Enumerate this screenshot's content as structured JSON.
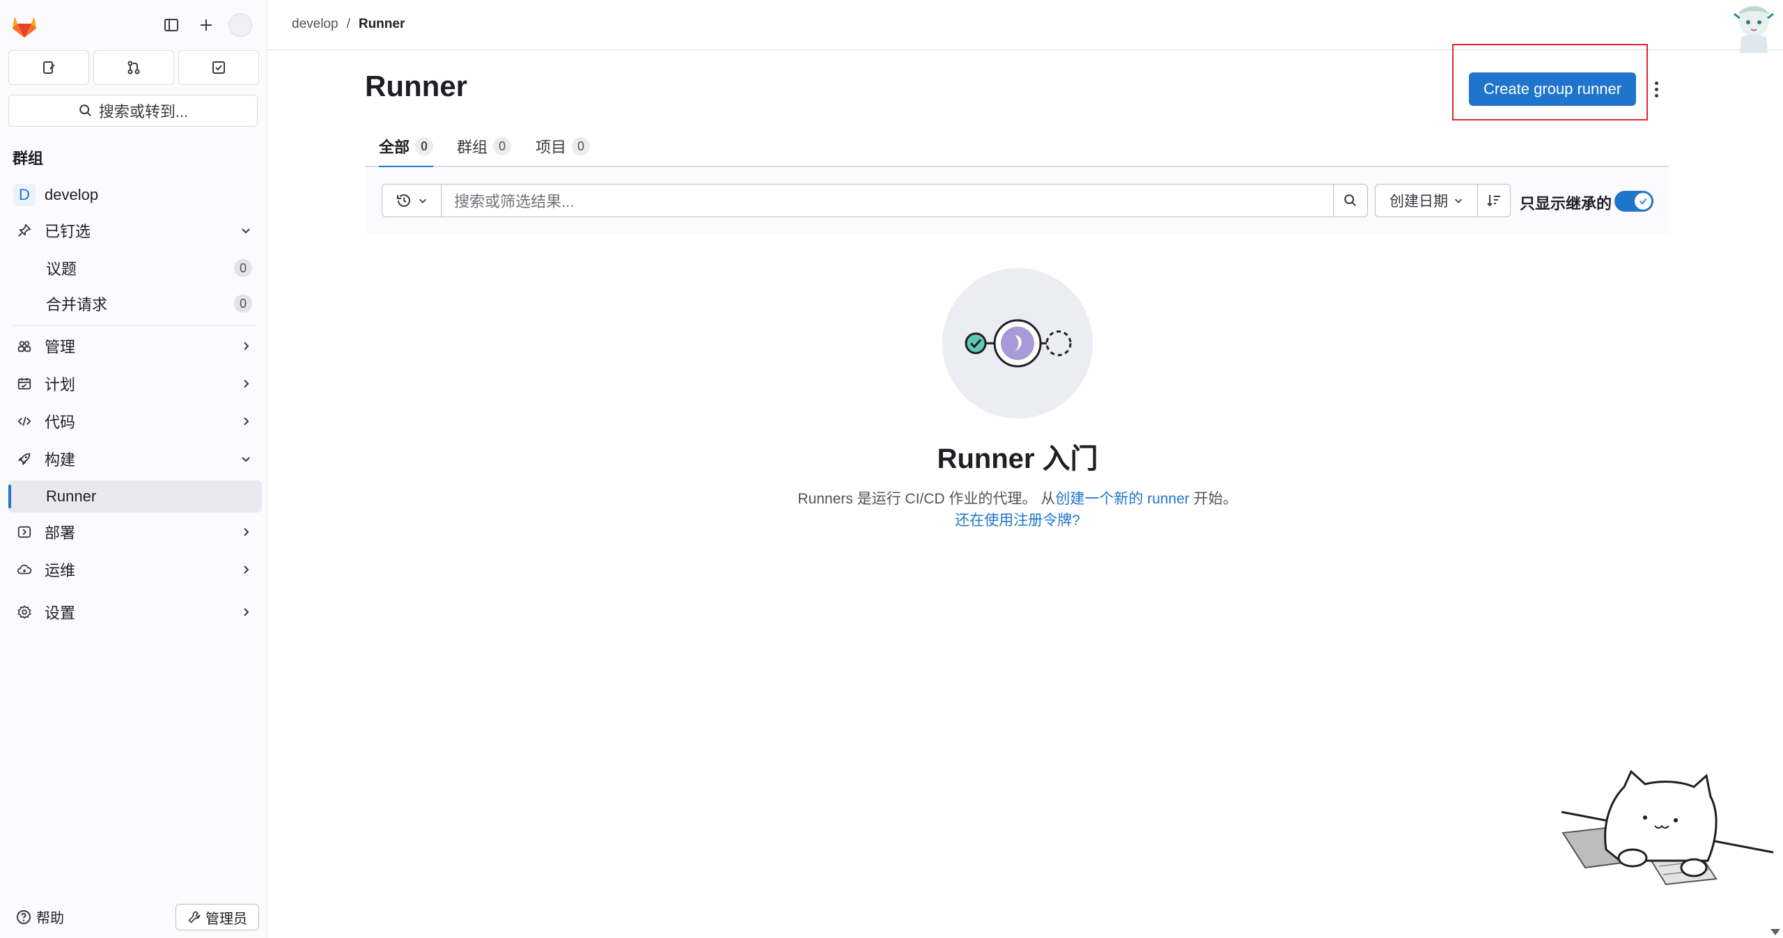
{
  "breadcrumb": {
    "parent": "develop",
    "separator": "/",
    "current": "Runner"
  },
  "sidebar": {
    "search_label": "搜索或转到...",
    "section_title": "群组",
    "group": {
      "avatar_letter": "D",
      "name": "develop"
    },
    "pinned": {
      "label": "已钉选",
      "items": [
        {
          "label": "议题",
          "count": "0"
        },
        {
          "label": "合并请求",
          "count": "0"
        }
      ]
    },
    "nav": {
      "manage": "管理",
      "plan": "计划",
      "code": "代码",
      "build": "构建",
      "runner": "Runner",
      "deploy": "部署",
      "operate": "运维",
      "settings": "设置"
    },
    "help": "帮助",
    "admin": "管理员"
  },
  "page": {
    "title": "Runner",
    "create_button": "Create group runner",
    "tabs": [
      {
        "label": "全部",
        "count": "0"
      },
      {
        "label": "群组",
        "count": "0"
      },
      {
        "label": "项目",
        "count": "0"
      }
    ],
    "filter": {
      "placeholder": "搜索或筛选结果...",
      "sort_label": "创建日期",
      "inherited_label": "只显示继承的",
      "inherited_on": true
    },
    "empty_state": {
      "title": "Runner 入门",
      "desc_prefix": "Runners 是运行 CI/CD 作业的代理。 从",
      "desc_link": "创建一个新的 runner",
      "desc_suffix": " 开始。",
      "token_link": "还在使用注册令牌?"
    }
  },
  "colors": {
    "accent": "#1f75cb",
    "highlight_box": "#e0262b",
    "logo": "#e24329"
  }
}
